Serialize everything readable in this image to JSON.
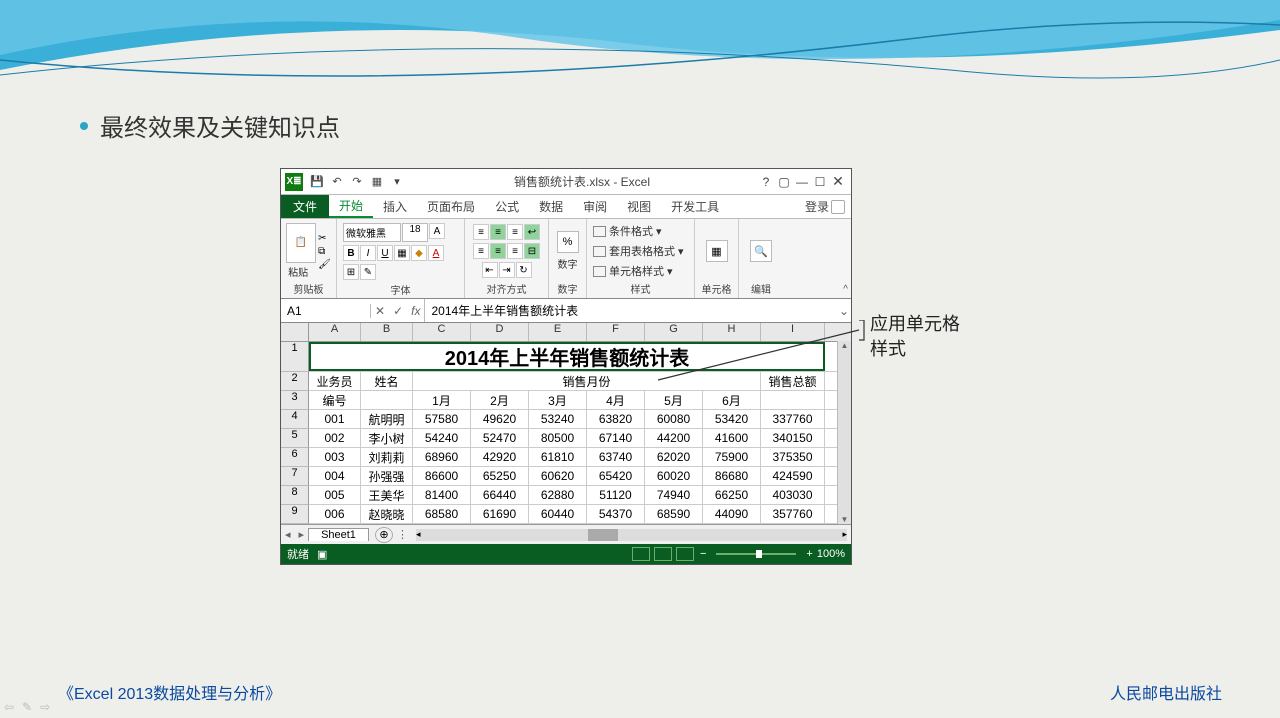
{
  "slide": {
    "bullet": "最终效果及关键知识点",
    "callout_line1": "应用单元格",
    "callout_line2": "样式",
    "footer_left": "《Excel 2013数据处理与分析》",
    "footer_right": "人民邮电出版社"
  },
  "excel": {
    "qat": {
      "logo": "X≣"
    },
    "title": "销售额统计表.xlsx - Excel",
    "tabs": {
      "file": "文件",
      "items": [
        "开始",
        "插入",
        "页面布局",
        "公式",
        "数据",
        "审阅",
        "视图",
        "开发工具"
      ],
      "active_index": 0,
      "login": "登录"
    },
    "ribbon": {
      "clipboard": {
        "paste": "粘贴",
        "label": "剪贴板"
      },
      "font": {
        "name": "微软雅黑",
        "size": "18",
        "label": "字体"
      },
      "align": {
        "label": "对齐方式"
      },
      "number": {
        "big": "%",
        "text": "数字",
        "label": "数字"
      },
      "styles": {
        "cond": "条件格式 ▾",
        "table": "套用表格格式 ▾",
        "cell": "单元格样式 ▾",
        "label": "样式"
      },
      "cells": {
        "text": "单元格"
      },
      "editing": {
        "text": "编辑"
      }
    },
    "formula_bar": {
      "name_box": "A1",
      "fx": "fx",
      "value": "2014年上半年销售额统计表"
    },
    "columns": [
      "A",
      "B",
      "C",
      "D",
      "E",
      "F",
      "G",
      "H",
      "I"
    ],
    "row_numbers": [
      "1",
      "2",
      "3",
      "4",
      "5",
      "6",
      "7",
      "8",
      "9"
    ],
    "sheet_title": "2014年上半年销售额统计表",
    "header_group": {
      "emp_id_top": "业务员",
      "emp_id_bot": "编号",
      "name": "姓名",
      "month_group": "销售月份",
      "months": [
        "1月",
        "2月",
        "3月",
        "4月",
        "5月",
        "6月"
      ],
      "total": "销售总额"
    },
    "rows": [
      {
        "id": "001",
        "name": "航明明",
        "m": [
          57580,
          49620,
          53240,
          63820,
          60080,
          53420
        ],
        "total": 337760
      },
      {
        "id": "002",
        "name": "李小树",
        "m": [
          54240,
          52470,
          80500,
          67140,
          44200,
          41600
        ],
        "total": 340150
      },
      {
        "id": "003",
        "name": "刘莉莉",
        "m": [
          68960,
          42920,
          61810,
          63740,
          62020,
          75900
        ],
        "total": 375350
      },
      {
        "id": "004",
        "name": "孙强强",
        "m": [
          86600,
          65250,
          60620,
          65420,
          60020,
          86680
        ],
        "total": 424590
      },
      {
        "id": "005",
        "name": "王美华",
        "m": [
          81400,
          66440,
          62880,
          51120,
          74940,
          66250
        ],
        "total": 403030
      },
      {
        "id": "006",
        "name": "赵晓晓",
        "m": [
          68580,
          61690,
          60440,
          54370,
          68590,
          44090
        ],
        "total": 357760
      }
    ],
    "sheet_tab": "Sheet1",
    "status": {
      "ready": "就绪",
      "zoom": "100%"
    }
  }
}
